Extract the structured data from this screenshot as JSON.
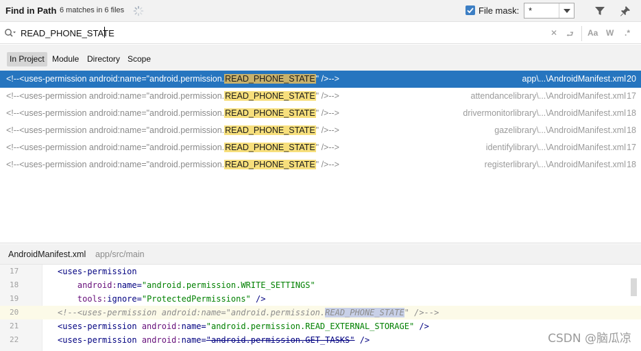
{
  "header": {
    "title": "Find in Path",
    "subtitle": "6 matches in 6 files",
    "file_mask_label": "File mask:",
    "file_mask_checked": true,
    "file_mask_value": "*",
    "accent_color": "#3d7fc4"
  },
  "search": {
    "query": "READ_PHONE_STATE",
    "icons": [
      "search-icon",
      "close-icon",
      "replace-icon",
      "match-case-icon",
      "words-icon",
      "regex-icon"
    ],
    "case_label": "Aa",
    "words_label": "W",
    "regex_label": ".*"
  },
  "scope": {
    "tabs": [
      {
        "label": "In Project",
        "active": true
      },
      {
        "label": "Module",
        "active": false
      },
      {
        "label": "Directory",
        "active": false
      },
      {
        "label": "Scope",
        "active": false
      }
    ]
  },
  "results": [
    {
      "prefix": "<!--<uses-permission android:name=\"android.permission.",
      "match": "READ_PHONE_STATE",
      "suffix": "\" />-->",
      "file": "app\\...\\AndroidManifest.xml",
      "line": "20",
      "selected": true
    },
    {
      "prefix": "<!--<uses-permission android:name=\"android.permission.",
      "match": "READ_PHONE_STATE",
      "suffix": "\" />-->",
      "file": "attendancelibrary\\...\\AndroidManifest.xml",
      "line": "17",
      "selected": false
    },
    {
      "prefix": "<!--<uses-permission android:name=\"android.permission.",
      "match": "READ_PHONE_STATE",
      "suffix": "\" />-->",
      "file": "drivermonitorlibrary\\...\\AndroidManifest.xml",
      "line": "18",
      "selected": false
    },
    {
      "prefix": "<!--<uses-permission android:name=\"android.permission.",
      "match": "READ_PHONE_STATE",
      "suffix": "\" />-->",
      "file": "gazelibrary\\...\\AndroidManifest.xml",
      "line": "18",
      "selected": false
    },
    {
      "prefix": "<!--<uses-permission android:name=\"android.permission.",
      "match": "READ_PHONE_STATE",
      "suffix": "\" />-->",
      "file": "identifylibrary\\...\\AndroidManifest.xml",
      "line": "17",
      "selected": false
    },
    {
      "prefix": "<!--<uses-permission android:name=\"android.permission.",
      "match": "READ_PHONE_STATE",
      "suffix": "\" />-->",
      "file": "registerlibrary\\...\\AndroidManifest.xml",
      "line": "18",
      "selected": false
    }
  ],
  "preview": {
    "file_name": "AndroidManifest.xml",
    "file_path": "app/src/main",
    "lines": [
      {
        "num": "17",
        "parts": [
          {
            "t": "tag",
            "s": "<uses-permission"
          }
        ]
      },
      {
        "num": "18",
        "parts": [
          {
            "t": "tag",
            "s": "    "
          },
          {
            "t": "attr",
            "s": "android:"
          },
          {
            "t": "tag",
            "s": "name="
          },
          {
            "t": "val",
            "s": "\"android.permission.WRITE_SETTINGS\""
          }
        ]
      },
      {
        "num": "19",
        "parts": [
          {
            "t": "tag",
            "s": "    "
          },
          {
            "t": "attr",
            "s": "tools:"
          },
          {
            "t": "tag",
            "s": "ignore="
          },
          {
            "t": "val",
            "s": "\"ProtectedPermissions\""
          },
          {
            "t": "tag",
            "s": " />"
          }
        ]
      },
      {
        "num": "20",
        "current": true,
        "parts": [
          {
            "t": "comment",
            "s": "<!--<uses-permission android:name=\"android.permission."
          },
          {
            "t": "match",
            "s": "READ_PHONE_STATE"
          },
          {
            "t": "comment",
            "s": "\" />-->"
          }
        ]
      },
      {
        "num": "21",
        "parts": [
          {
            "t": "tag",
            "s": "<uses-permission "
          },
          {
            "t": "attr",
            "s": "android:"
          },
          {
            "t": "tag",
            "s": "name="
          },
          {
            "t": "val",
            "s": "\"android.permission.READ_EXTERNAL_STORAGE\""
          },
          {
            "t": "tag",
            "s": " />"
          }
        ]
      },
      {
        "num": "22",
        "parts": [
          {
            "t": "tag",
            "s": "<uses-permission "
          },
          {
            "t": "attr",
            "s": "android:"
          },
          {
            "t": "tag",
            "s": "name="
          },
          {
            "t": "strike",
            "s": "\"android.permission.GET_TASKS\""
          },
          {
            "t": "tag",
            "s": " />"
          }
        ]
      }
    ]
  },
  "watermark": "CSDN @脑瓜凉"
}
